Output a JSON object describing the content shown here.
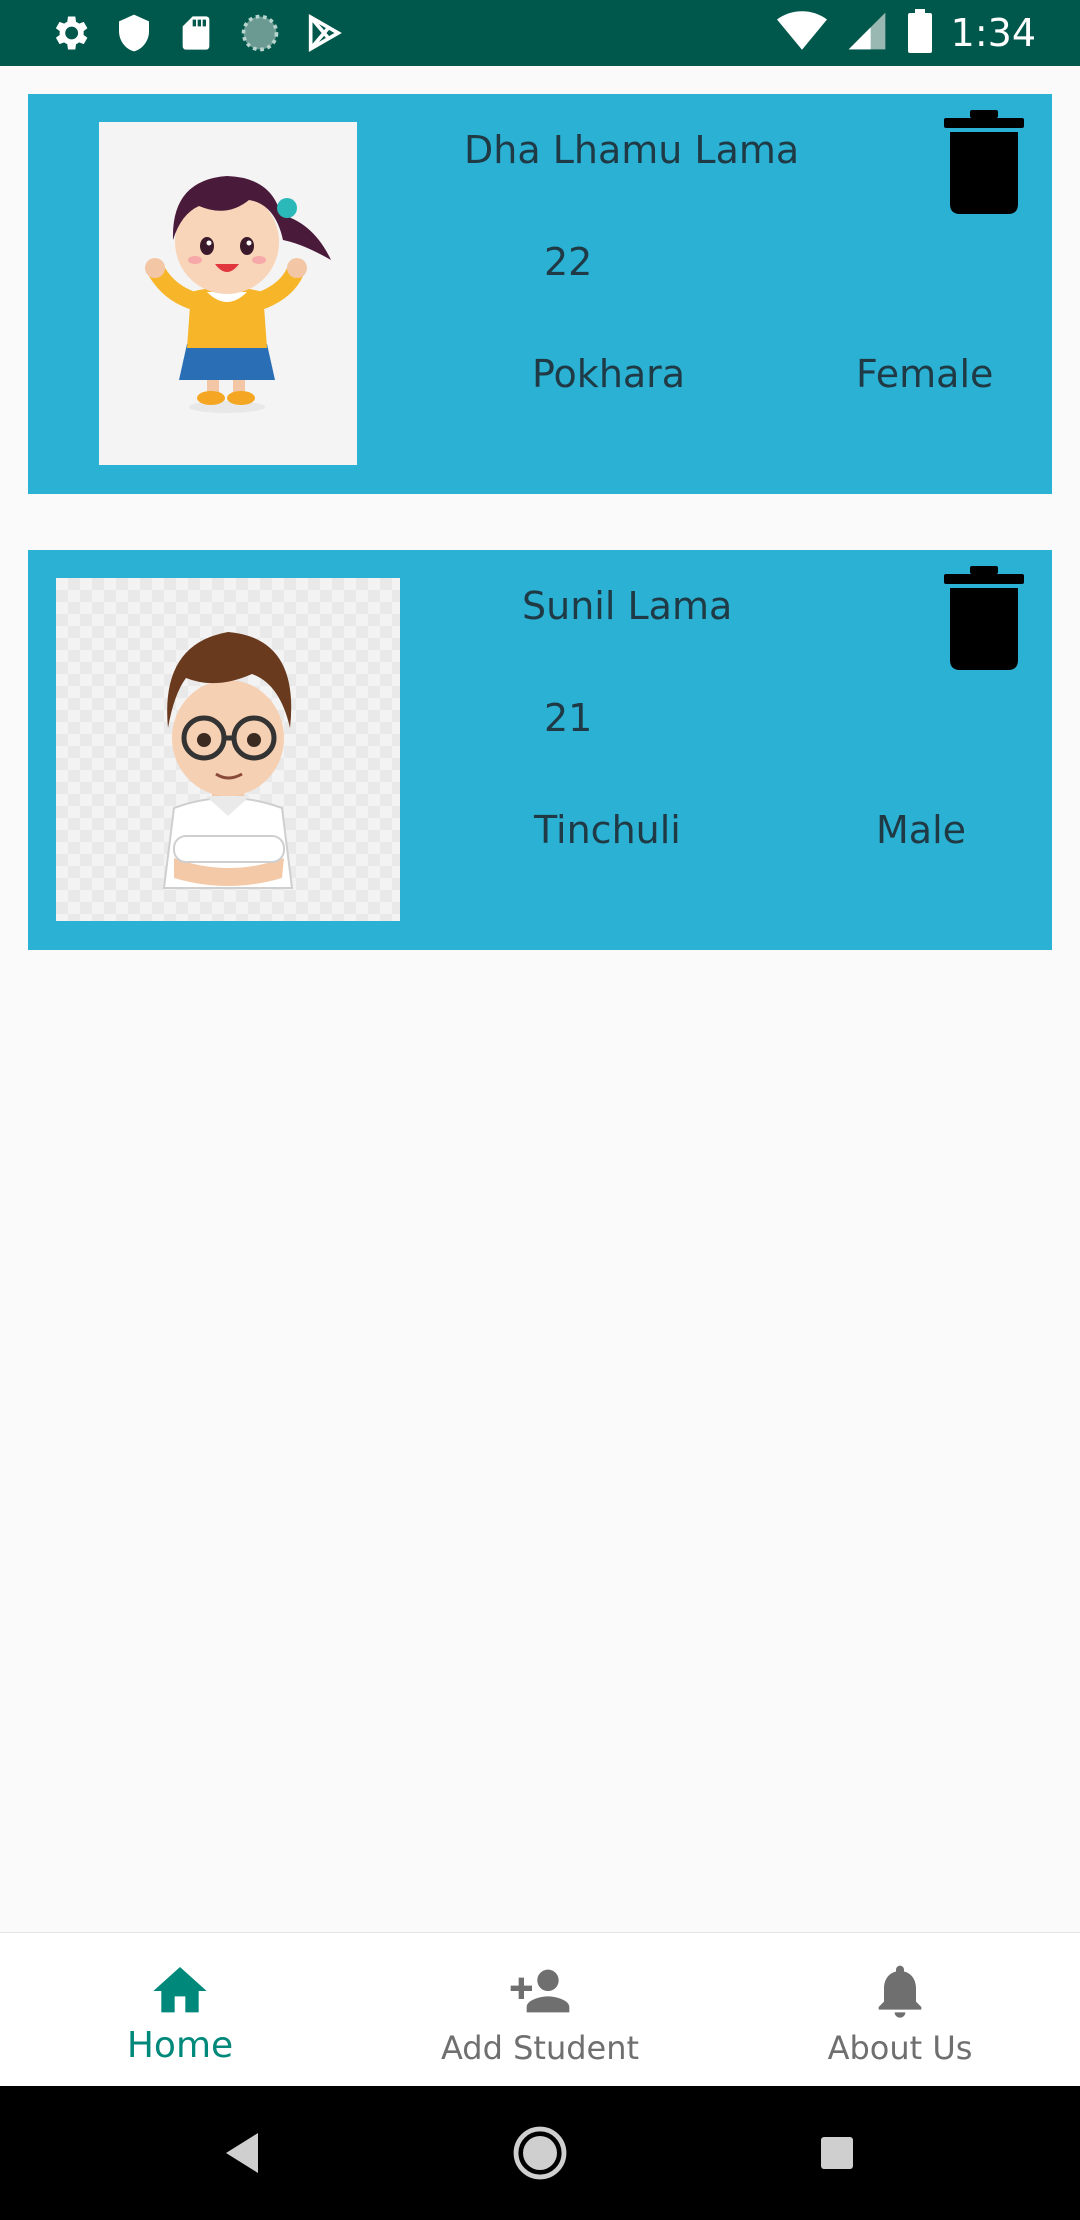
{
  "status_bar": {
    "time": "1:34",
    "icons": [
      "gear-icon",
      "shield-icon",
      "sd-card-icon",
      "loading-icon",
      "play-store-icon",
      "wifi-icon",
      "signal-icon",
      "battery-icon"
    ]
  },
  "students": [
    {
      "name": "Dha Lhamu Lama",
      "age": "22",
      "city": "Pokhara",
      "gender": "Female"
    },
    {
      "name": "Sunil Lama",
      "age": "21",
      "city": "Tinchuli",
      "gender": "Male"
    }
  ],
  "bottom_nav": {
    "items": [
      {
        "label": "Home",
        "icon": "home-icon",
        "active": true
      },
      {
        "label": "Add Student",
        "icon": "add-person-icon",
        "active": false
      },
      {
        "label": "About Us",
        "icon": "bell-icon",
        "active": false
      }
    ]
  },
  "colors": {
    "status_bar": "#00574b",
    "card": "#2bb1d4",
    "accent": "#00897b",
    "inactive": "#6f6f6f"
  }
}
